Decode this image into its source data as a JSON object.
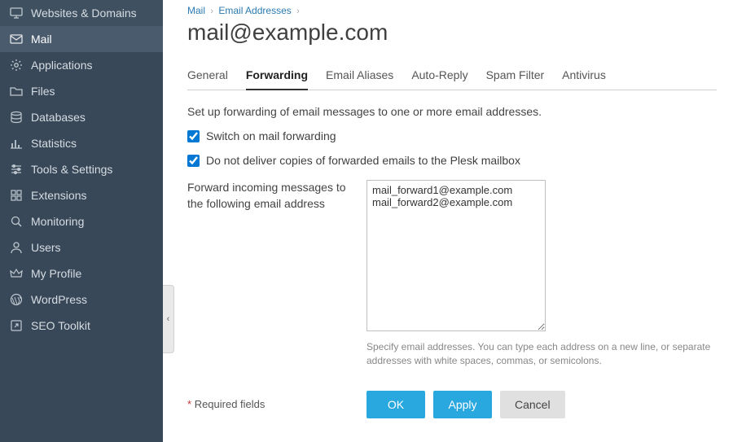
{
  "sidebar": [
    {
      "label": "Websites & Domains",
      "icon": "monitor-icon"
    },
    {
      "label": "Mail",
      "icon": "mail-icon",
      "active": true
    },
    {
      "label": "Applications",
      "icon": "gear-icon"
    },
    {
      "label": "Files",
      "icon": "folder-icon"
    },
    {
      "label": "Databases",
      "icon": "database-icon"
    },
    {
      "label": "Statistics",
      "icon": "chart-icon"
    },
    {
      "label": "Tools & Settings",
      "icon": "sliders-icon"
    },
    {
      "label": "Extensions",
      "icon": "grid-icon"
    },
    {
      "label": "Monitoring",
      "icon": "search-icon"
    },
    {
      "label": "Users",
      "icon": "user-icon"
    },
    {
      "label": "My Profile",
      "icon": "crown-icon"
    },
    {
      "label": "WordPress",
      "icon": "wordpress-icon"
    },
    {
      "label": "SEO Toolkit",
      "icon": "launch-icon"
    }
  ],
  "breadcrumb": {
    "items": [
      "Mail",
      "Email Addresses"
    ]
  },
  "page_title": "mail@example.com",
  "tabs": [
    {
      "label": "General"
    },
    {
      "label": "Forwarding",
      "active": true
    },
    {
      "label": "Email Aliases"
    },
    {
      "label": "Auto-Reply"
    },
    {
      "label": "Spam Filter"
    },
    {
      "label": "Antivirus"
    }
  ],
  "description": "Set up forwarding of email messages to one or more email addresses.",
  "checkbox_switch": {
    "label": "Switch on mail forwarding",
    "checked": true
  },
  "checkbox_nodeliver": {
    "label": "Do not deliver copies of forwarded emails to the Plesk mailbox",
    "checked": true
  },
  "forward_label": "Forward incoming messages to the following email address",
  "forward_value": "mail_forward1@example.com\nmail_forward2@example.com",
  "forward_hint": "Specify email addresses. You can type each address on a new line, or separate addresses with white spaces, commas, or semicolons.",
  "required_label": "Required fields",
  "buttons": {
    "ok": "OK",
    "apply": "Apply",
    "cancel": "Cancel"
  },
  "collapse_glyph": "‹"
}
